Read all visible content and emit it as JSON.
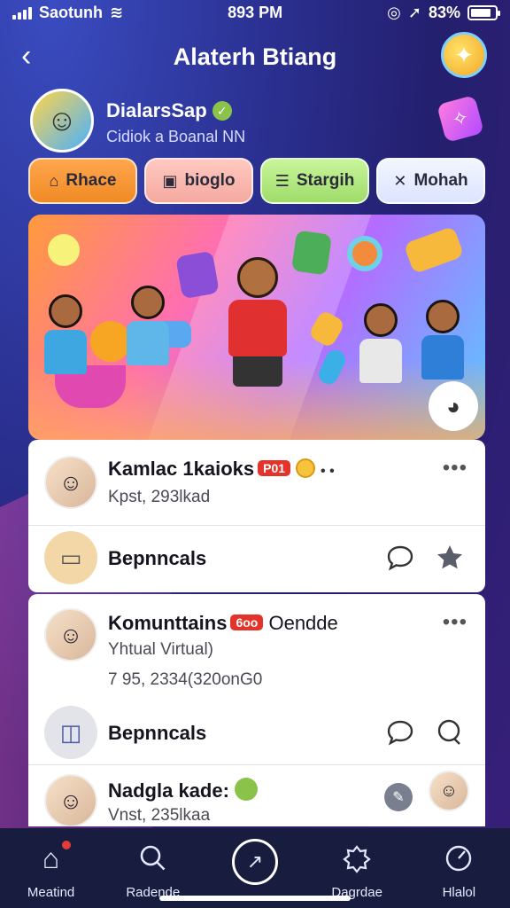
{
  "status": {
    "carrier": "Saotunh",
    "time": "893 PM",
    "battery": "83%"
  },
  "header": {
    "title": "Alaterh Btiang"
  },
  "profile": {
    "name": "DialarsSap",
    "subtitle": "Cidiok a Boanal NN"
  },
  "chips": [
    {
      "label": "Rhace",
      "icon": "home-icon"
    },
    {
      "label": "bioglo",
      "icon": "camera-icon"
    },
    {
      "label": "Stargih",
      "icon": "note-icon"
    },
    {
      "label": "Mohah",
      "icon": "close-icon"
    }
  ],
  "feed": {
    "card1": {
      "name": "Kamlac 1kaioks",
      "tag": "P01",
      "sub": "Kpst, 293lkad",
      "action_label": "Bepnncals"
    },
    "card2": {
      "name": "Komunttains",
      "tag": "6oo",
      "name_suffix": "Oendde",
      "sub1": "Yhtual Virtual)",
      "sub2": "7 95, 2334(320onG0",
      "action_label": "Bepnncals",
      "user3_name": "Nadgla kade:",
      "user3_sub": "Vnst, 235lkaa"
    }
  },
  "tabs": [
    {
      "label": "Meatind",
      "icon": "home-icon"
    },
    {
      "label": "Radende",
      "icon": "search-icon"
    },
    {
      "label": "",
      "icon": "compose-icon"
    },
    {
      "label": "Dagrdae",
      "icon": "chat-icon"
    },
    {
      "label": "Hlalol",
      "icon": "profile-icon"
    }
  ],
  "colors": {
    "accent_orange": "#f08a24",
    "accent_green": "#9fdc6b",
    "tab_bg": "#181c3e",
    "badge_red": "#e4332a"
  }
}
